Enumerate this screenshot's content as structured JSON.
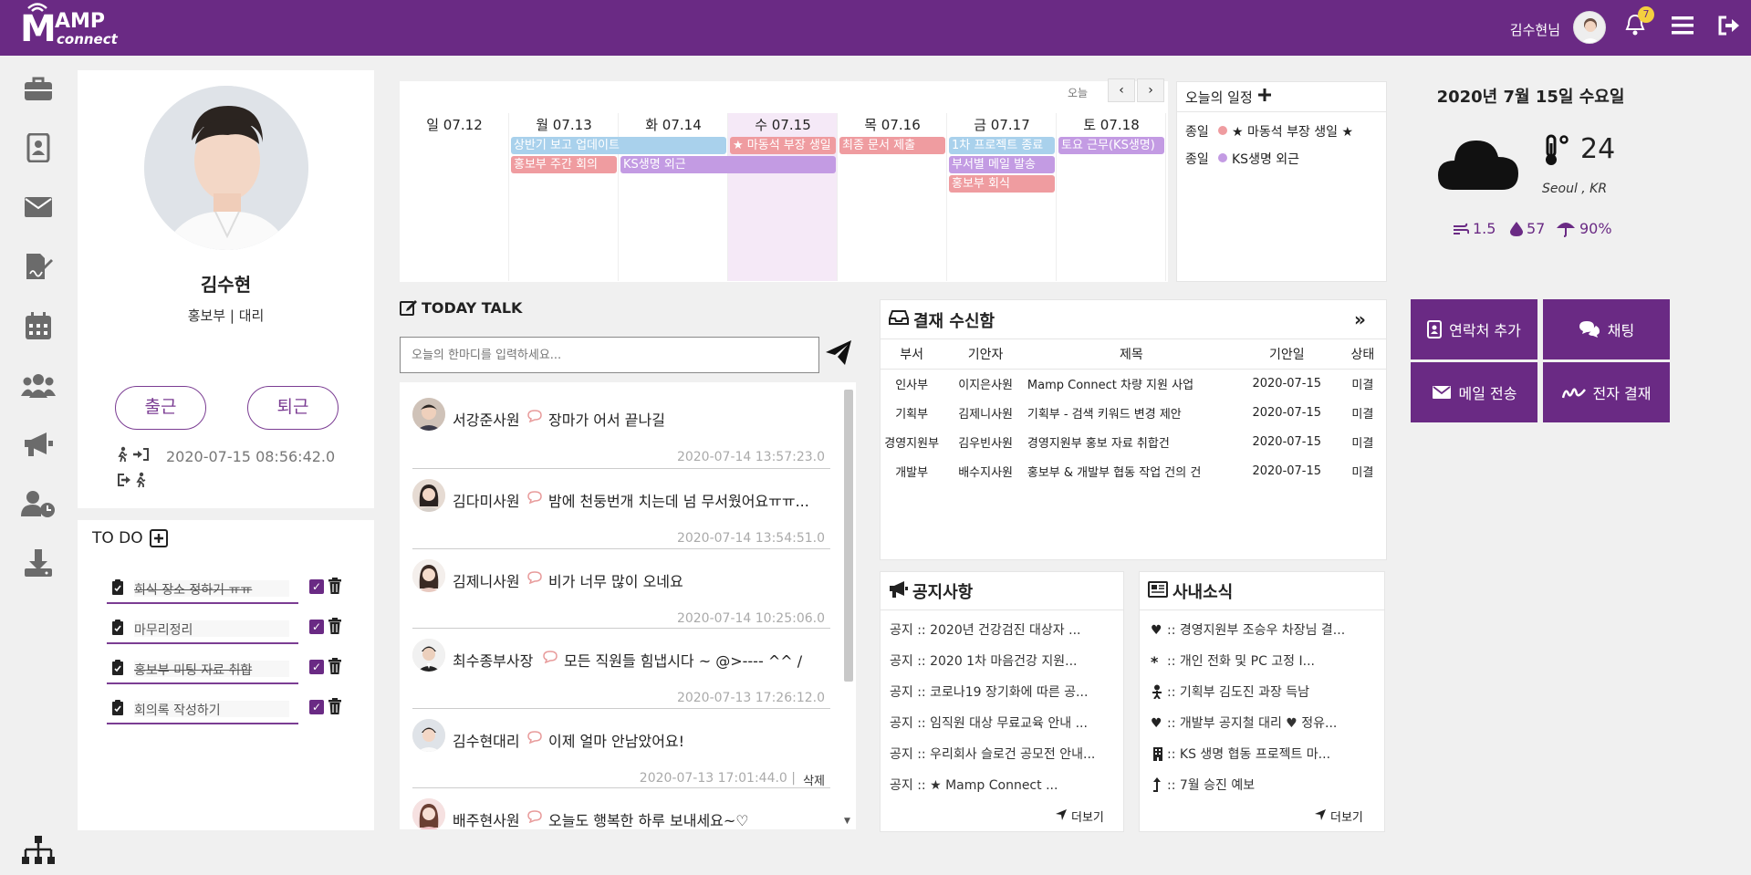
{
  "header": {
    "logo_main": "AMP",
    "logo_m": "M",
    "logo_sub": "connect",
    "user_label": "김수현님",
    "notification_count": "7"
  },
  "profile": {
    "name": "김수현",
    "dept_rank": "홍보부 | 대리",
    "checkin_label": "출근",
    "checkout_label": "퇴근",
    "checkin_time": "2020-07-15 08:56:42.0"
  },
  "todo": {
    "title": "TO DO",
    "items": [
      {
        "text": "회식 장소 정하기 ㅠㅠ",
        "done": true
      },
      {
        "text": "마무리정리",
        "done": false
      },
      {
        "text": "홍보부 미팅 자료 취합",
        "done": true
      },
      {
        "text": "회의록 작성하기",
        "done": false
      }
    ]
  },
  "calendar": {
    "today_label": "오늘",
    "days": [
      "일 07.12",
      "월 07.13",
      "화 07.14",
      "수 07.15",
      "목 07.16",
      "금 07.17",
      "토 07.18"
    ],
    "events": {
      "e1": "상반기 보고 업데이트",
      "e2": "홍보부 주간 회의",
      "e3": "KS생명 외근",
      "e4": "★ 마동석 부장 생일",
      "e5": "최종 문서 제출",
      "e6": "1차 프로젝트 종료",
      "e7": "부서별 메일 발송",
      "e8": "홍보부 회식",
      "e9": "토요 근무(KS생명)"
    },
    "today_schedule_title": "오늘의 일정",
    "today_schedule": [
      {
        "time": "종일",
        "text": "★ 마동석 부장 생일 ★",
        "color": "#ef9ca0"
      },
      {
        "time": "종일",
        "text": "KS생명 외근",
        "color": "#c39be3"
      }
    ]
  },
  "weather": {
    "date": "2020년 7월 15일 수요일",
    "temp": "24",
    "location": "Seoul , KR",
    "wind": "1.5",
    "humidity": "57",
    "rain": "90%"
  },
  "talk": {
    "title": "TODAY TALK",
    "placeholder": "오늘의 한마디를 입력하세요...",
    "delete_label": "삭제",
    "items": [
      {
        "name": "서강준사원",
        "msg": "장마가 어서 끝나길",
        "time": "2020-07-14 13:57:23.0"
      },
      {
        "name": "김다미사원",
        "msg": "밤에 천둥번개 치는데 넘 무서웠어요ㅠㅠ...",
        "time": "2020-07-14 13:54:51.0"
      },
      {
        "name": "김제니사원",
        "msg": "비가 너무 많이 오네요",
        "time": "2020-07-14 10:25:06.0"
      },
      {
        "name": "최수종부사장",
        "msg": "모든 직원들 힘냅시다 ~ @>---- ^^ /",
        "time": "2020-07-13 17:26:12.0"
      },
      {
        "name": "김수현대리",
        "msg": "이제 얼마 안남았어요!",
        "time": "2020-07-13 17:01:44.0 |"
      },
      {
        "name": "배주현사원",
        "msg": "오늘도 행복한 하루 보내세요~♡",
        "time": ""
      }
    ]
  },
  "approval": {
    "title": "결재 수신함",
    "headers": [
      "부서",
      "기안자",
      "제목",
      "기안일",
      "상태"
    ],
    "rows": [
      [
        "인사부",
        "이지은사원",
        "Mamp Connect 차량 지원 사업",
        "2020-07-15",
        "미결"
      ],
      [
        "기획부",
        "김제니사원",
        "기획부 - 검색 키워드 변경 제안",
        "2020-07-15",
        "미결"
      ],
      [
        "경영지원부",
        "김우빈사원",
        "경영지원부 홍보 자료 취합건",
        "2020-07-15",
        "미결"
      ],
      [
        "개발부",
        "배수지사원",
        "홍보부 & 개발부 협동 작업 건의 건",
        "2020-07-15",
        "미결"
      ]
    ]
  },
  "quick": {
    "contact": "연락처 추가",
    "chat": "채팅",
    "mail": "메일 전송",
    "sign": "전자 결재"
  },
  "notice": {
    "title": "공지사항",
    "more": "더보기",
    "items": [
      "공지 :: 2020년 건강검진 대상자 ...",
      "공지 :: 2020 1차 마음건강 지원...",
      "공지 :: 코로나19 장기화에 따른 공...",
      "공지 :: 임직원 대상 무료교육 안내 ...",
      "공지 :: 우리회사 슬로건 공모전 안내...",
      "공지 :: ★ Mamp Connect ..."
    ]
  },
  "news": {
    "title": "사내소식",
    "more": "더보기",
    "items": [
      ":: 경영지원부 조승우 차장님 결...",
      ":: 개인 전화 및 PC 고정 I...",
      ":: 기획부 김도진 과장 득남",
      ":: 개발부 공지철 대리 ♥ 정유...",
      ":: KS 생명 협동 프로젝트 마...",
      ":: 7월 승진 예보"
    ]
  }
}
